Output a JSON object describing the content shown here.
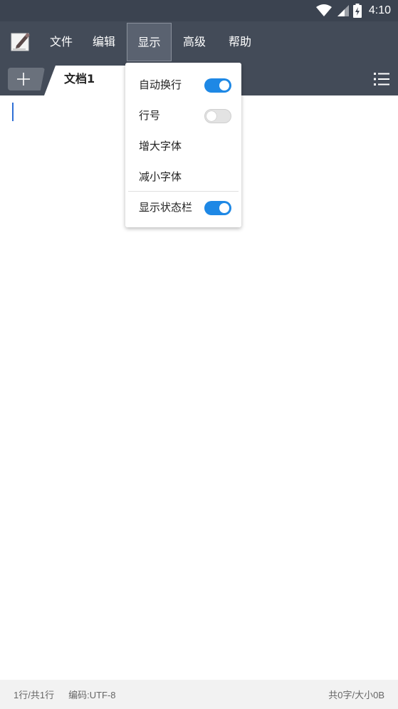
{
  "status_bar": {
    "time": "4:10",
    "icons": [
      "wifi-icon",
      "signal-icon",
      "battery-charging-icon"
    ]
  },
  "menu": {
    "logo_icon": "notepad-pen-icon",
    "items": [
      {
        "label": "文件",
        "active": false
      },
      {
        "label": "编辑",
        "active": false
      },
      {
        "label": "显示",
        "active": true
      },
      {
        "label": "高级",
        "active": false
      },
      {
        "label": "帮助",
        "active": false
      }
    ]
  },
  "tabs": {
    "add_icon": "plus-icon",
    "active_tab": "文档1",
    "list_icon": "list-menu-icon"
  },
  "dropdown": {
    "items": [
      {
        "label": "自动换行",
        "toggle": true
      },
      {
        "label": "行号",
        "toggle": false
      },
      {
        "label": "增大字体"
      },
      {
        "label": "减小字体"
      },
      {
        "label": "显示状态栏",
        "toggle": true
      }
    ]
  },
  "status": {
    "line": "1行/共1行",
    "encoding": "编码:UTF-8",
    "size": "共0字/大小0B"
  },
  "colors": {
    "toolbar": "#434b58",
    "statusbar": "#3b4350",
    "accent": "#1e88e5"
  }
}
